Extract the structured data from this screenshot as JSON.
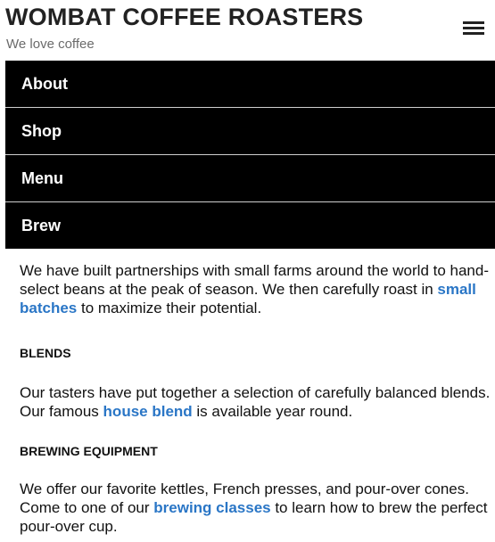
{
  "header": {
    "title": "WOMBAT COFFEE ROASTERS",
    "tagline": "We love coffee",
    "menu_icon": "hamburger-menu-icon"
  },
  "nav": {
    "items": [
      {
        "label": "About"
      },
      {
        "label": "Shop"
      },
      {
        "label": "Menu"
      },
      {
        "label": "Brew"
      }
    ]
  },
  "content": {
    "intro": {
      "before": "We have built partnerships with small farms around the world to hand-select beans at the peak of season. We then carefully roast in ",
      "link": "small batches",
      "after": " to maximize their potential."
    },
    "blends": {
      "heading": "BLENDS",
      "before": "Our tasters have put together a selection of carefully balanced blends. Our famous ",
      "link": "house blend",
      "after": " is available year round."
    },
    "equipment": {
      "heading": "BREWING EQUIPMENT",
      "before": "We offer our favorite kettles, French presses, and pour-over cones. Come to one of our ",
      "link": "brewing classes",
      "after": " to learn how to brew the perfect pour-over cup."
    }
  },
  "colors": {
    "link": "#2a76c6",
    "nav_background": "#000000",
    "nav_text": "#ffffff",
    "tagline": "#6b6b6b"
  }
}
